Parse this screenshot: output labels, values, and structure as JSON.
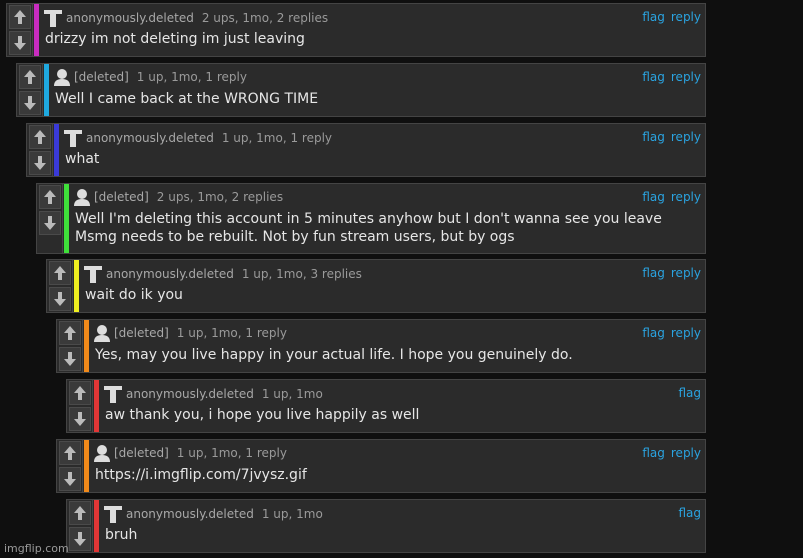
{
  "colors": {
    "magenta": "#c92cc0",
    "cyan": "#1fa9e0",
    "blue": "#3a3ad8",
    "green": "#3fe03a",
    "yellow": "#f0f020",
    "orange": "#f28a1a",
    "red": "#e23636",
    "link": "#2aa3e0"
  },
  "comments": [
    {
      "user": "anonymously.deleted",
      "avatar": "tshirt-icon",
      "stats": "2 ups, 1mo, 2 replies",
      "flag": "flag",
      "reply": "reply",
      "text": "drizzy im not deleting im just leaving"
    },
    {
      "user": "[deleted]",
      "avatar": "person-icon",
      "stats": "1 up, 1mo, 1 reply",
      "flag": "flag",
      "reply": "reply",
      "text": "Well I came back at the WRONG TIME"
    },
    {
      "user": "anonymously.deleted",
      "avatar": "tshirt-icon",
      "stats": "1 up, 1mo, 1 reply",
      "flag": "flag",
      "reply": "reply",
      "text": "what"
    },
    {
      "user": "[deleted]",
      "avatar": "person-icon",
      "stats": "2 ups, 1mo, 2 replies",
      "flag": "flag",
      "reply": "reply",
      "text_line1": "Well I'm deleting this account in 5 minutes anyhow but I don't wanna see you leave",
      "text_line2": "Msmg needs to be rebuilt. Not by fun stream users, but by ogs"
    },
    {
      "user": "anonymously.deleted",
      "avatar": "tshirt-icon",
      "stats": "1 up, 1mo, 3 replies",
      "flag": "flag",
      "reply": "reply",
      "text": "wait do ik you"
    },
    {
      "user": "[deleted]",
      "avatar": "person-icon",
      "stats": "1 up, 1mo, 1 reply",
      "flag": "flag",
      "reply": "reply",
      "text": "Yes, may you live happy in your actual life. I hope you genuinely do."
    },
    {
      "user": "anonymously.deleted",
      "avatar": "tshirt-icon",
      "stats": "1 up, 1mo",
      "flag": "flag",
      "text": "aw thank you, i hope you live happily as well"
    },
    {
      "user": "[deleted]",
      "avatar": "person-icon",
      "stats": "1 up, 1mo, 1 reply",
      "flag": "flag",
      "reply": "reply",
      "text": "https://i.imgflip.com/7jvysz.gif"
    },
    {
      "user": "anonymously.deleted",
      "avatar": "tshirt-icon",
      "stats": "1 up, 1mo",
      "flag": "flag",
      "text": "bruh"
    }
  ],
  "watermark": "imgflip.com"
}
